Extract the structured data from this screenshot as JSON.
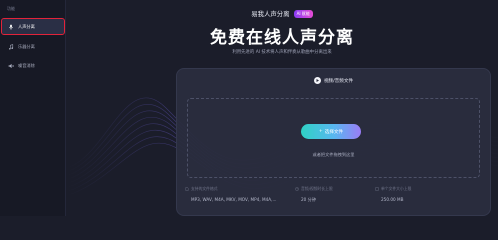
{
  "sidebar": {
    "section_label": "功能",
    "items": [
      {
        "label": "人声分离",
        "icon": "microphone-icon",
        "active": true
      },
      {
        "label": "乐器分离",
        "icon": "music-icon",
        "active": false
      },
      {
        "label": "噪音消除",
        "icon": "noise-icon",
        "active": false
      }
    ]
  },
  "header": {
    "brand": "易我人声分离",
    "badge": "AI 赋能",
    "headline": "免费在线人声分离",
    "subline": "利用先进的 AI 技术将人声和伴奏从歌曲中分离出来"
  },
  "upload": {
    "title": "视频/音频文件",
    "button_label": "选择文件",
    "button_icon": "plus-icon",
    "drop_hint": "或者把文件拖拽到这里",
    "info": [
      {
        "label": "支持的文件格式",
        "value": "MP3, WAV, M4A, MKV, MOV, MP4, M4A,...",
        "icon": "file-icon"
      },
      {
        "label": "音频/视频时长上限",
        "value": "20 分钟",
        "icon": "clock-icon"
      },
      {
        "label": "单个文件大小上限",
        "value": "250.00 MB",
        "icon": "size-icon"
      }
    ]
  },
  "colors": {
    "background": "#1b1d2a",
    "sidebar": "#171925",
    "highlight_border": "#e2233a",
    "button_gradient_start": "#2fd1c4",
    "button_gradient_end": "#9a7cf6",
    "badge_gradient_start": "#8a3cf5",
    "badge_gradient_end": "#e54bd4"
  }
}
